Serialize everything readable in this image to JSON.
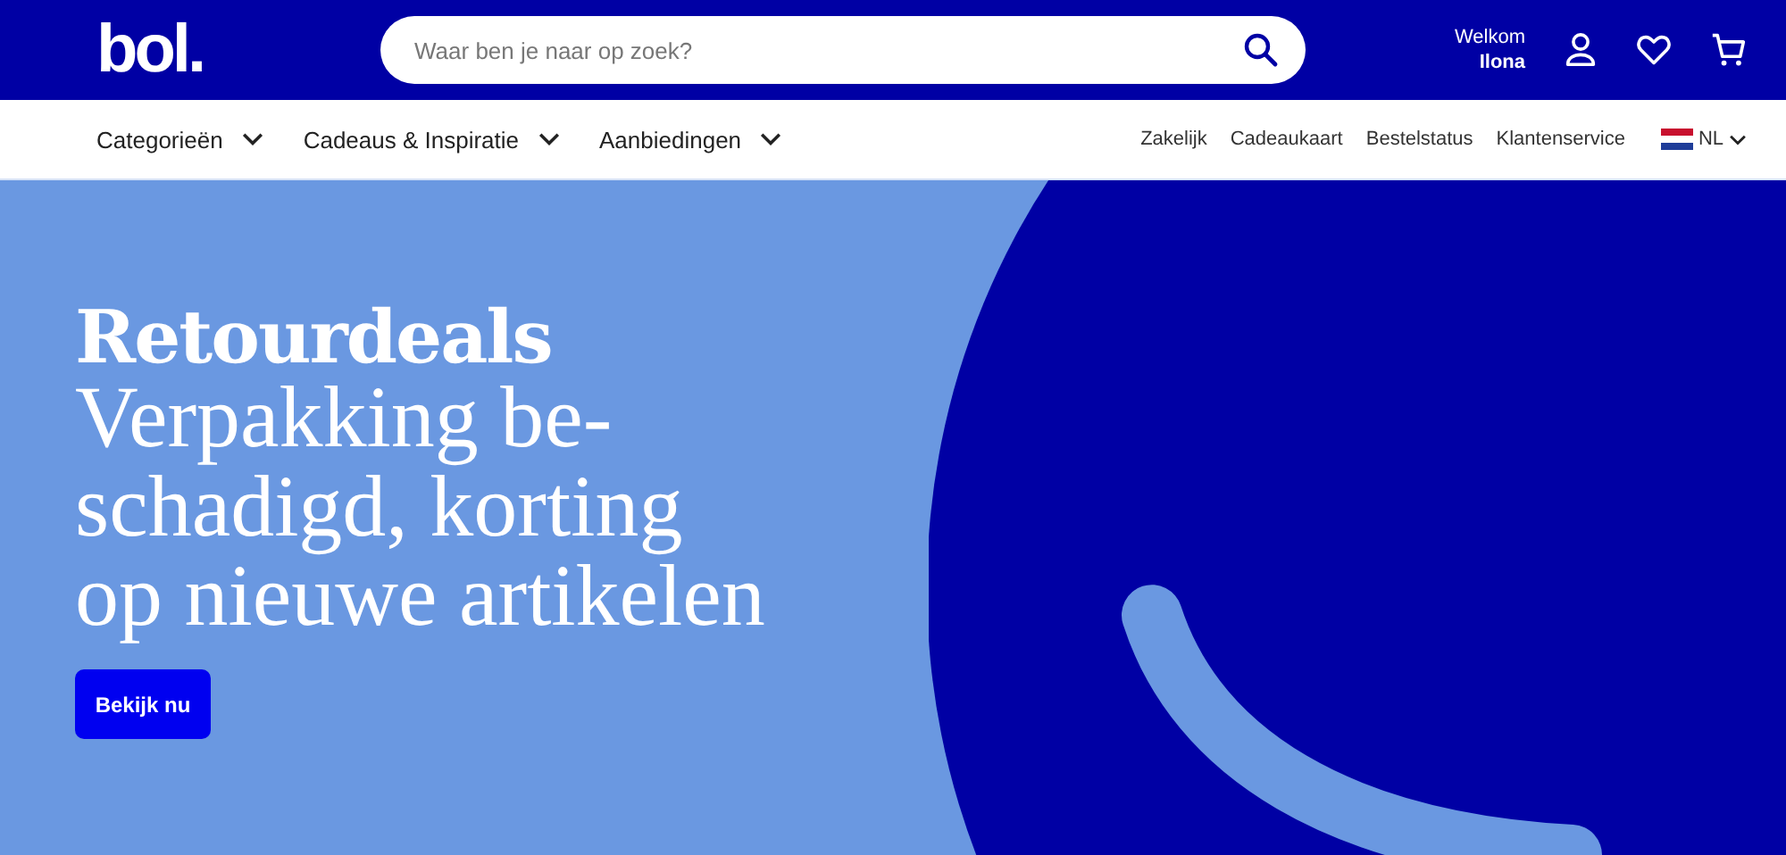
{
  "header": {
    "logo": "bol.",
    "search": {
      "placeholder": "Waar ben je naar op zoek?"
    },
    "greeting": "Welkom",
    "user": "Ilona"
  },
  "nav": {
    "menus": [
      {
        "label": "Categorieën"
      },
      {
        "label": "Cadeaus & Inspiratie"
      },
      {
        "label": "Aanbiedingen"
      }
    ],
    "links": [
      "Zakelijk",
      "Cadeaukaart",
      "Bestelstatus",
      "Klantenservice"
    ],
    "language": "NL"
  },
  "hero": {
    "title": "Retourdeals",
    "subtitle_lines": [
      "Verpakking be-",
      "schadigd, korting",
      "op nieuwe artikelen"
    ],
    "button": "Bekijk nu"
  }
}
